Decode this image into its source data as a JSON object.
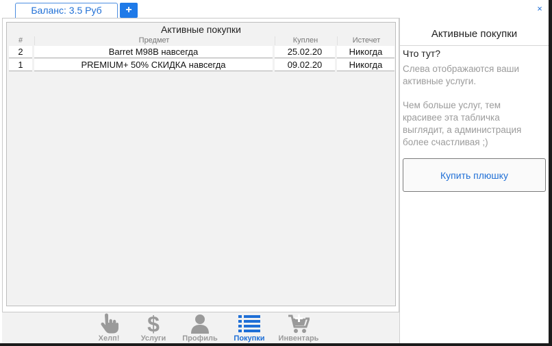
{
  "tabs": {
    "balance_label": "Баланс: 3.5 Руб",
    "add_label": "+",
    "close_label": "×"
  },
  "table": {
    "title": "Активные покупки",
    "headers": [
      "#",
      "Предмет",
      "Куплен",
      "Истечет"
    ],
    "rows": [
      [
        "2",
        "Barret M98B навсегда",
        "25.02.20",
        "Никогда"
      ],
      [
        "1",
        "PREMIUM+ 50% СКИДКА навсегда",
        "09.02.20",
        "Никогда"
      ]
    ]
  },
  "nav": [
    {
      "label": "Хелп!",
      "icon": "hand-pointer-icon"
    },
    {
      "label": "Услуги",
      "icon": "dollar-icon"
    },
    {
      "label": "Профиль",
      "icon": "user-icon"
    },
    {
      "label": "Покупки",
      "icon": "list-icon",
      "active": true
    },
    {
      "label": "Инвентарь",
      "icon": "cart-plus-icon"
    }
  ],
  "side": {
    "title": "Активные покупки",
    "heading": "Что тут?",
    "text1": "Слева отображаются ваши активные услуги.",
    "text2": "Чем больше услуг, тем красивее эта табличка выглядит, а администрация более счастливая ;)",
    "buy_label": "Купить плюшку"
  },
  "colors": {
    "accent": "#1f7ae8",
    "muted": "#9a9a9a"
  }
}
